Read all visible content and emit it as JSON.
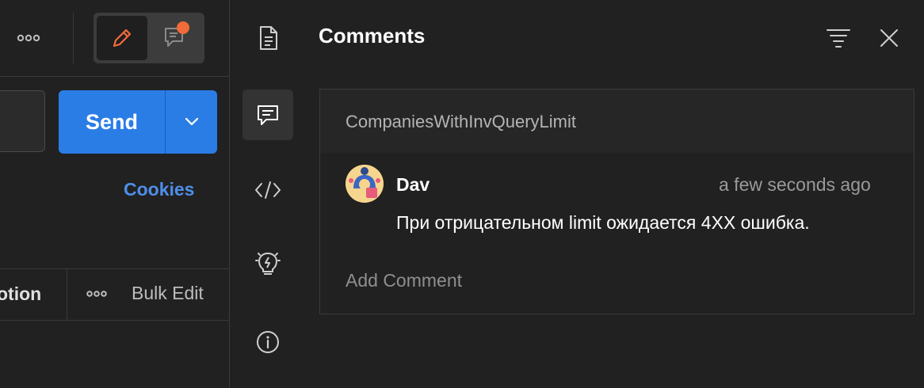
{
  "toolbar": {
    "more_icon": "more-horizontal-icon",
    "edit_icon": "pencil-icon",
    "comment_icon": "comment-notification-icon",
    "notification_color": "#f26b3a"
  },
  "request": {
    "send_label": "Send",
    "send_menu_icon": "chevron-down-icon",
    "cookies_label": "Cookies",
    "partial_column_label": "otion",
    "bulk_edit_label": "Bulk Edit"
  },
  "rail": {
    "items": [
      {
        "name": "documentation",
        "icon": "document-icon",
        "active": false
      },
      {
        "name": "comments",
        "icon": "comment-icon",
        "active": true
      },
      {
        "name": "code",
        "icon": "code-icon",
        "active": false
      },
      {
        "name": "ideas",
        "icon": "lightbulb-icon",
        "active": false
      },
      {
        "name": "info",
        "icon": "info-icon",
        "active": false
      }
    ]
  },
  "comments_panel": {
    "title": "Comments",
    "filter_icon": "filter-icon",
    "close_icon": "close-icon",
    "thread": {
      "request_name": "CompaniesWithInvQueryLimit",
      "comments": [
        {
          "author": "Dav",
          "time": "a few seconds ago",
          "text": "При отрицательном limit ожидается 4XX ошибка."
        }
      ],
      "add_comment_placeholder": "Add Comment"
    }
  },
  "colors": {
    "accent": "#2b7de6",
    "link": "#4e8ee8",
    "background": "#212121"
  }
}
